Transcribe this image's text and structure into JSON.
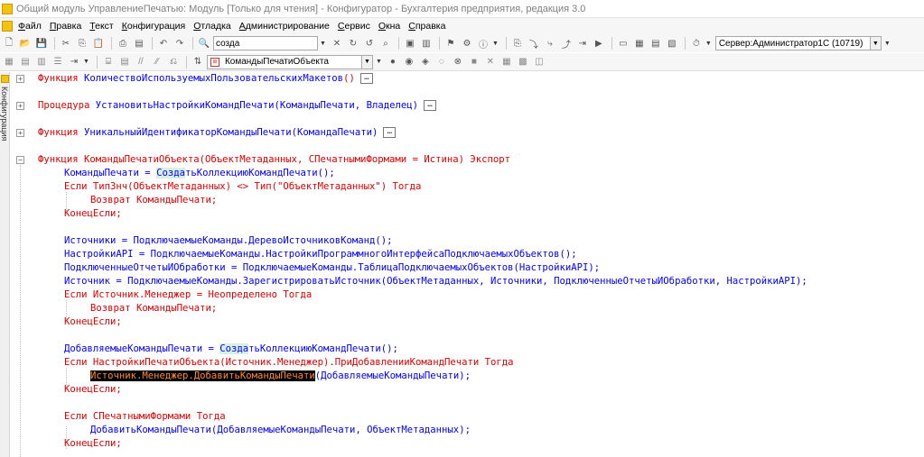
{
  "window": {
    "title": "Общий модуль УправлениеПечатью: Модуль [Только для чтения] - Конфигуратор - Бухгалтерия предприятия, редакция 3.0"
  },
  "menu": [
    {
      "label": "Файл"
    },
    {
      "label": "Правка"
    },
    {
      "label": "Текст"
    },
    {
      "label": "Конфигурация"
    },
    {
      "label": "Отладка"
    },
    {
      "label": "Администрирование"
    },
    {
      "label": "Сервис"
    },
    {
      "label": "Окна"
    },
    {
      "label": "Справка"
    }
  ],
  "toolbar": {
    "search_value": "созда",
    "server_label": "Сервер:Администратор1С (10719)",
    "procedure_value": "КомандыПечатиОбъекта"
  },
  "side_panel": {
    "label": "Конфигурация"
  },
  "code": {
    "line1_kw": "Функция",
    "line1_name": "КоличествоИспользуемыхПользовательскихМакетов",
    "line1_rest": "()",
    "line2_kw": "Процедура",
    "line2_name": "УстановитьНастройкиКомандПечати",
    "line2_rest": "(КомандыПечати, Владелец)",
    "line3_kw": "Функция",
    "line3_name": "УникальныйИдентификаторКомандыПечати",
    "line3_rest": "(КомандаПечати)",
    "line4": "Функция КомандыПечатиОбъекта(ОбъектМетаданных, СПечатнымиФормами = Истина) Экспорт",
    "line5_a": "КомандыПечати = ",
    "line5_b": "Созда",
    "line5_c": "тьКоллекциюКомандПечати();",
    "line6": "Если ТипЗнч(ОбъектМетаданных) <> Тип(\"ОбъектМетаданных\") Тогда",
    "line7": "Возврат КомандыПечати;",
    "line8": "КонецЕсли;",
    "line9": "Источники = ПодключаемыеКоманды.ДеревоИсточниковКоманд();",
    "line10": "НастройкиAPI = ПодключаемыеКоманды.НастройкиПрограммногоИнтерфейсаПодключаемыхОбъектов();",
    "line11": "ПодключенныеОтчетыИОбработки = ПодключаемыеКоманды.ТаблицаПодключаемыхОбъектов(НастройкиAPI);",
    "line12": "Источник = ПодключаемыеКоманды.ЗарегистрироватьИсточник(ОбъектМетаданных, Источники, ПодключенныеОтчетыИОбработки, НастройкиAPI);",
    "line13": "Если Источник.Менеджер = Неопределено Тогда",
    "line14": "Возврат КомандыПечати;",
    "line15": "КонецЕсли;",
    "line16_a": "ДобавляемыеКомандыПечати = ",
    "line16_b": "Созда",
    "line16_c": "тьКоллекциюКомандПечати();",
    "line17": "Если НастройкиПечатиОбъекта(Источник.Менеджер).ПриДобавленииКомандПечати Тогда",
    "line18_sel": "Источник.Менеджер.ДобавитьКомандыПечати",
    "line18_rest": "(ДобавляемыеКомандыПечати);",
    "line19": "КонецЕсли;",
    "line20": "Если СПечатнымиФормами Тогда",
    "line21": "ДобавитьКомандыПечати(ДобавляемыеКомандыПечати, ОбъектМетаданных);",
    "line22": "КонецЕсли;"
  },
  "colors": {
    "keyword": "#e00000",
    "identifier": "#0000ff",
    "selection_bg": "#000000",
    "selection_fg": "#ff8a2b",
    "match_highlight": "#d7f0e1"
  }
}
